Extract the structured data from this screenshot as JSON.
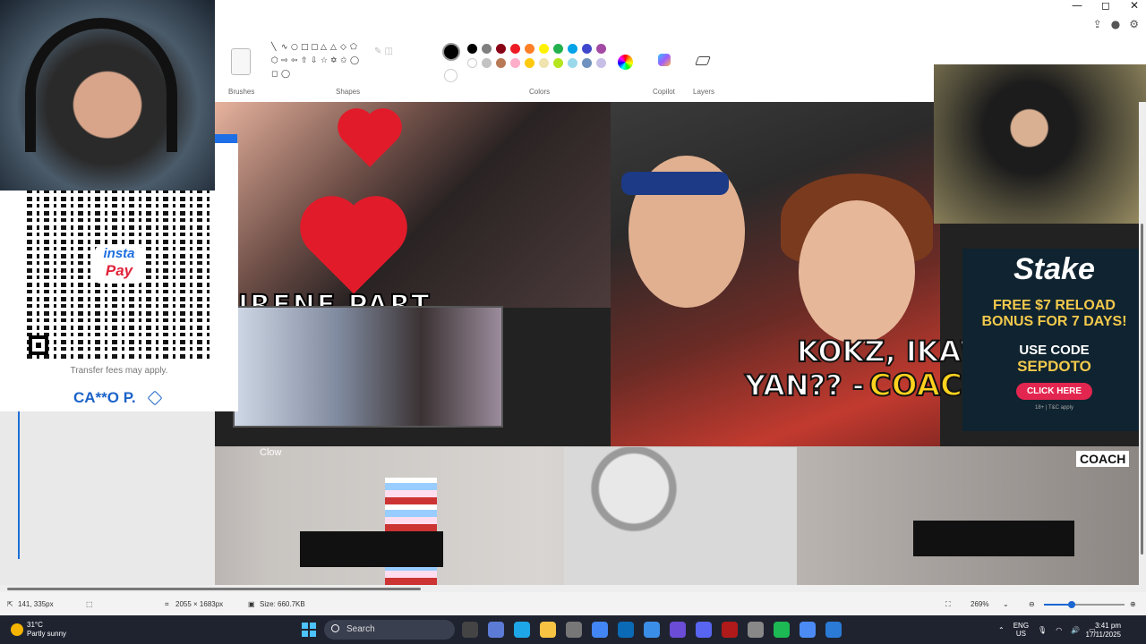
{
  "window": {
    "controls": [
      "—",
      "◻",
      "✕"
    ]
  },
  "ribbon": {
    "groups": {
      "brushes": "Brushes",
      "shapes": "Shapes",
      "colors": "Colors",
      "copilot": "Copilot",
      "layers": "Layers"
    },
    "shape_glyphs": [
      "╲",
      "∿",
      "○",
      "□",
      "▢",
      "△",
      "△",
      "◇",
      "⬠",
      "⬡",
      "⇨",
      "⇦",
      "⇧",
      "⇩",
      "☆",
      "✡",
      "✩",
      "◯",
      "◻",
      "◯"
    ],
    "primary_color": "#000000",
    "secondary_color": "#ffffff",
    "palette": [
      "#000000",
      "#7f7f7f",
      "#880015",
      "#ed1c24",
      "#ff7f27",
      "#fff200",
      "#22b14c",
      "#00a2e8",
      "#3f48cc",
      "#a349a4",
      "#ffffff",
      "#c3c3c3",
      "#b97a57",
      "#ffaec9",
      "#ffc90e",
      "#efe4b0",
      "#b5e61d",
      "#99d9ea",
      "#7092be",
      "#c8bfe7"
    ]
  },
  "qr_panel": {
    "logo_line1": "insta",
    "logo_line2": "Pay",
    "fee_note": "Transfer fees may apply.",
    "account_name": "CA**O P."
  },
  "canvas": {
    "thumb_title": "IRENE   PART",
    "headline_line1": "KOKZ, IKAW BA",
    "headline_line2a": "YAN?? -",
    "headline_line2b": "COACH IRENE",
    "clown_tag": "Clow",
    "coach_label": "COACH"
  },
  "ad": {
    "brand": "Stake",
    "offer_line1": "FREE $7 RELOAD",
    "offer_line2": "BONUS FOR 7 DAYS!",
    "use_code": "USE CODE",
    "code": "SEPDOTO",
    "cta": "CLICK HERE",
    "fine": "18+ | T&C apply"
  },
  "status": {
    "cursor_pos": "141, 335px",
    "image_size": "2055 × 1683px",
    "file_size": "Size: 660.7KB",
    "zoom": "269%"
  },
  "taskbar": {
    "temp": "31°C",
    "condition": "Partly sunny",
    "search_label": "Search",
    "lang": "ENG",
    "region": "US",
    "time": "3:41 pm",
    "date": "17/11/2025",
    "app_colors": [
      "#444",
      "#5b7bd6",
      "#1ea7e8",
      "#f6c343",
      "#777",
      "#4285f4",
      "#0a6ab5",
      "#3b8ee8",
      "#6b4cd6",
      "#5865f2",
      "#b11a1a",
      "#888",
      "#1db954",
      "#4c8bf5",
      "#2a7ad6"
    ]
  }
}
